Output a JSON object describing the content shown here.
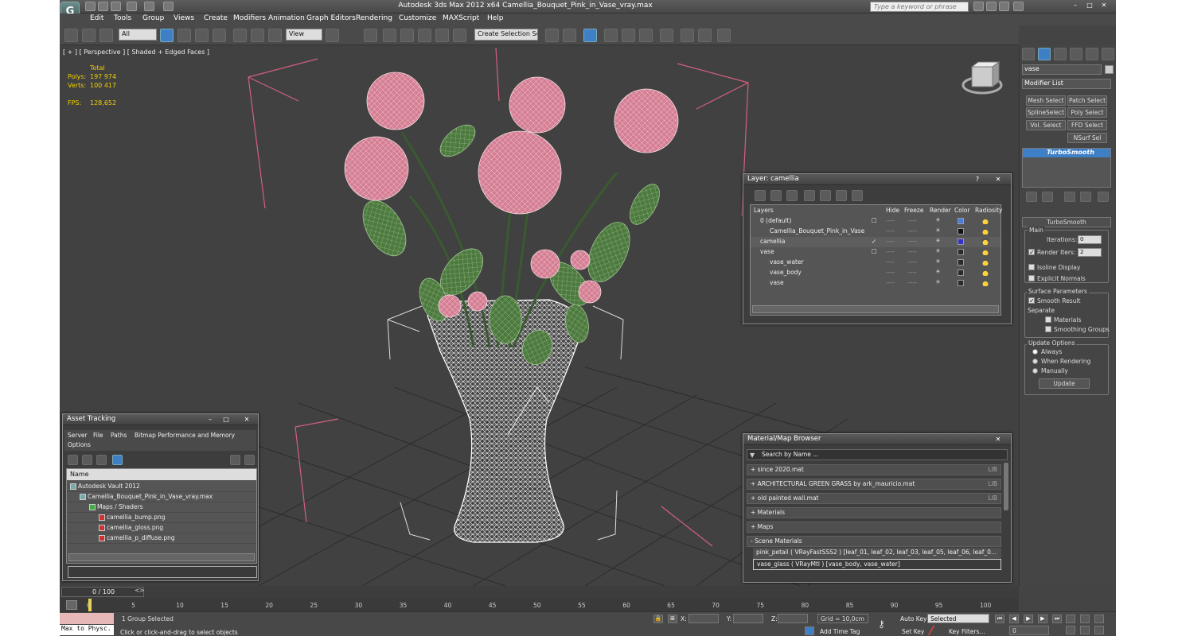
{
  "window": {
    "title": "Autodesk 3ds Max  2012 x64       Camellia_Bouquet_Pink_in_Vase_vray.max",
    "search_placeholder": "Type a keyword or phrase"
  },
  "menu": [
    "Edit",
    "Tools",
    "Group",
    "Views",
    "Create",
    "Modifiers",
    "Animation",
    "Graph Editors",
    "Rendering",
    "Customize",
    "MAXScript",
    "Help"
  ],
  "toolbar": {
    "selection_filter": "All",
    "ref_coord": "View",
    "named_selection": "Create Selection Se",
    "snap_label": "3"
  },
  "viewport": {
    "label": "[ + ] [ Perspective ] [ Shaded + Edged Faces ]",
    "total_label": "Total",
    "polys_label": "Polys:",
    "polys": "197 974",
    "verts_label": "Verts:",
    "verts": "100 417",
    "fps_label": "FPS:",
    "fps": "128,652"
  },
  "command_panel": {
    "object_name": "vase",
    "modifier_list": "Modifier List",
    "buttons": [
      "Mesh Select",
      "Patch Select",
      "SplineSelect",
      "Poly Select",
      "Vol. Select",
      "FFD Select",
      "NSurf Sel"
    ],
    "stack_item": "TurboSmooth",
    "rollout_title": "TurboSmooth",
    "main_label": "Main",
    "iterations_label": "Iterations:",
    "iterations": "0",
    "render_iters_label": "Render Iters:",
    "render_iters": "2",
    "isoline": "Isoline Display",
    "explicit": "Explicit Normals",
    "surface_label": "Surface Parameters",
    "smooth_result": "Smooth Result",
    "separate_label": "Separate",
    "materials": "Materials",
    "smoothing_groups": "Smoothing Groups",
    "update_label": "Update Options",
    "always": "Always",
    "when_rendering": "When Rendering",
    "manually": "Manually",
    "update_button": "Update"
  },
  "layer_dialog": {
    "title": "Layer: camellia",
    "columns": [
      "Layers",
      "Hide",
      "Freeze",
      "Render",
      "Color",
      "Radiosity"
    ],
    "rows": [
      {
        "name": "0 (default)",
        "indent": 0,
        "color": "#4a7be0",
        "box": "☐"
      },
      {
        "name": "Camellia_Bouquet_Pink_in_Vase",
        "indent": 1,
        "color": "#111111",
        "box": ""
      },
      {
        "name": "camellia",
        "indent": 0,
        "color": "#3333cc",
        "box": "✓"
      },
      {
        "name": "vase",
        "indent": 0,
        "color": "#2a2a2a",
        "box": "☐"
      },
      {
        "name": "vase_water",
        "indent": 1,
        "color": "#2a2a2a",
        "box": ""
      },
      {
        "name": "vase_body",
        "indent": 1,
        "color": "#2a2a2a",
        "box": ""
      },
      {
        "name": "vase",
        "indent": 1,
        "color": "#2a2a2a",
        "box": ""
      }
    ],
    "cell_marks": {
      "hide": "----",
      "freeze": "----",
      "render": "☀"
    }
  },
  "asset_tracking": {
    "title": "Asset Tracking",
    "menu": [
      "Server",
      "File",
      "Paths",
      "Bitmap Performance and Memory"
    ],
    "options": "Options",
    "column": "Name",
    "rows": [
      "Autodesk Vault 2012",
      "Camellia_Bouquet_Pink_in_Vase_vray.max",
      "Maps / Shaders",
      "camellia_bump.png",
      "camellia_gloss.png",
      "camellia_p_diffuse.png"
    ]
  },
  "material_browser": {
    "title": "Material/Map Browser",
    "search_placeholder": "Search by Name ...",
    "rows": [
      {
        "label": "+ since 2020.mat",
        "tag": "LIB"
      },
      {
        "label": "+ ARCHITECTURAL GREEN GRASS by ark_mauricio.mat",
        "tag": "LIB"
      },
      {
        "label": "+ old painted wall.mat",
        "tag": "LIB"
      },
      {
        "label": "+ Materials",
        "tag": ""
      },
      {
        "label": "+ Maps",
        "tag": ""
      },
      {
        "label": "- Scene Materials",
        "tag": ""
      }
    ],
    "scene_materials": [
      "pink_petail  ( VRayFastSSS2 )  [leaf_01, leaf_02, leaf_03, leaf_05, leaf_06, leaf_0...",
      "vase_glass  ( VRayMtl )  [vase_body, vase_water]"
    ]
  },
  "timeline": {
    "frame": "0 / 100",
    "ticks": [
      "0",
      "5",
      "10",
      "15",
      "20",
      "25",
      "30",
      "35",
      "40",
      "45",
      "50",
      "55",
      "60",
      "65",
      "70",
      "75",
      "80",
      "85",
      "90",
      "95",
      "100"
    ]
  },
  "status": {
    "maxscript": "Max to Physc.",
    "selected": "1 Group Selected",
    "prompt": "Click or click-and-drag to select objects",
    "x_label": "X:",
    "y_label": "Y:",
    "z_label": "Z:",
    "grid": "Grid = 10,0cm",
    "add_time_tag": "Add Time Tag",
    "auto_key": "Auto Key",
    "set_key": "Set Key",
    "key_mode": "Selected",
    "key_filters": "Key Filters...",
    "frame_field": "0"
  },
  "colors": {
    "ui_bg": "#444444",
    "viewport_bg": "#414141",
    "accent": "#3f7fc6",
    "stats": "#f0d000",
    "petal": "#d57f94",
    "leaf": "#4d7a3e",
    "frame_lines": "#d2607e"
  }
}
